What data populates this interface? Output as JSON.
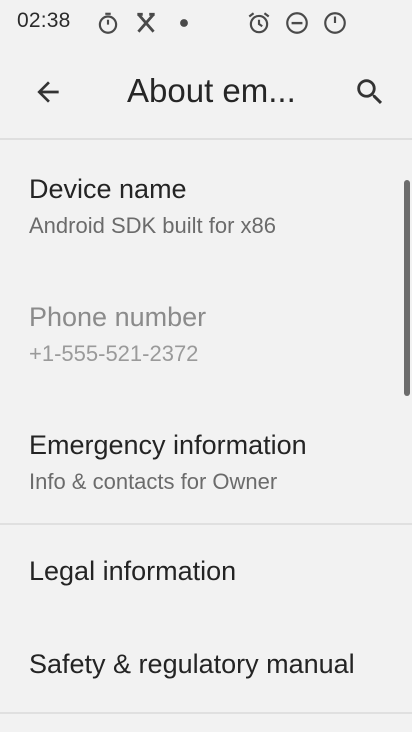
{
  "status_bar": {
    "time": "02:38",
    "left_icons": [
      "stopwatch-icon",
      "missed-call-icon",
      "notification-dot-icon"
    ],
    "right_icons": [
      "alarm-icon",
      "do-not-disturb-icon",
      "battery-icon"
    ]
  },
  "app_bar": {
    "title": "About em...",
    "back_icon": "arrow-back-icon",
    "search_icon": "search-icon"
  },
  "items": [
    {
      "title": "Device name",
      "subtitle": "Android SDK built for x86",
      "enabled": true
    },
    {
      "title": "Phone number",
      "subtitle": "+1-555-521-2372",
      "enabled": false
    },
    {
      "title": "Emergency information",
      "subtitle": "Info & contacts for Owner",
      "enabled": true
    },
    {
      "title": "Legal information",
      "subtitle": "",
      "enabled": true
    },
    {
      "title": "Safety & regulatory manual",
      "subtitle": "",
      "enabled": true
    }
  ],
  "colors": {
    "background": "#f2f2f2",
    "primary_text": "#242424",
    "secondary_text": "#6b6b6b",
    "disabled_text": "#8b8b8b",
    "divider": "#e0e0e0",
    "scrollbar": "#6c6c6c"
  }
}
